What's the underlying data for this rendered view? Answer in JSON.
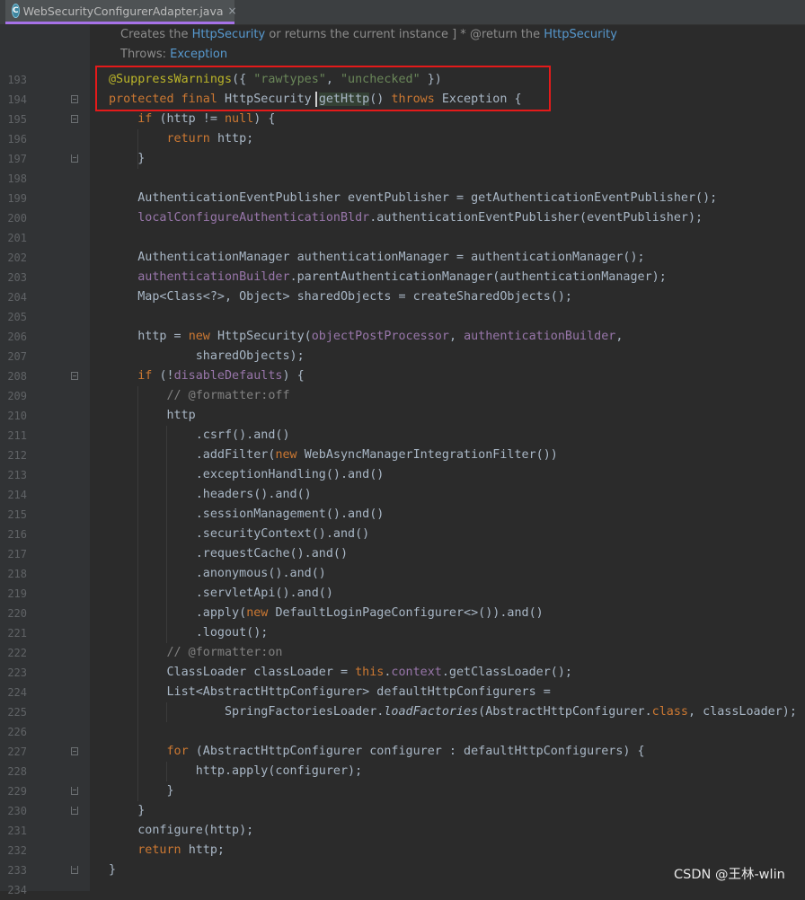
{
  "tab": {
    "title": "WebSecurityConfigurerAdapter.java",
    "icon": "java-class-icon",
    "close": "×"
  },
  "doc": {
    "line1": [
      {
        "t": "Creates the ",
        "c": ""
      },
      {
        "t": "HttpSecurity",
        "c": "code"
      },
      {
        "t": " or returns the current instance ] * @return the ",
        "c": ""
      },
      {
        "t": "HttpSecurity",
        "c": "code"
      }
    ],
    "line2": [
      {
        "t": "Throws: ",
        "c": ""
      },
      {
        "t": "Exception",
        "c": "code"
      }
    ]
  },
  "code_lines": [
    {
      "n": "193",
      "tokens": [
        [
          "@SuppressWarnings",
          "ann"
        ],
        [
          "({ ",
          ""
        ],
        [
          "\"rawtypes\"",
          "str"
        ],
        [
          ", ",
          ""
        ],
        [
          "\"unchecked\"",
          "str"
        ],
        [
          " })",
          ""
        ]
      ]
    },
    {
      "n": "194",
      "fold": "start",
      "tokens": [
        [
          "protected final ",
          "kw"
        ],
        [
          "HttpSecurity ",
          ""
        ],
        [
          "getHttp",
          "hl"
        ],
        [
          "() ",
          ""
        ],
        [
          "throws ",
          "kw"
        ],
        [
          "Exception {",
          ""
        ]
      ]
    },
    {
      "n": "195",
      "fold": "start",
      "tokens": [
        [
          "    "
        ],
        [
          "if ",
          "kw"
        ],
        [
          "(http != ",
          ""
        ],
        [
          "null",
          "kw"
        ],
        [
          ") {",
          ""
        ]
      ]
    },
    {
      "n": "196",
      "tokens": [
        [
          "        "
        ],
        [
          "return ",
          "kw"
        ],
        [
          "http;",
          ""
        ]
      ]
    },
    {
      "n": "197",
      "fold": "end",
      "tokens": [
        [
          "    }",
          ""
        ]
      ]
    },
    {
      "n": "198",
      "tokens": []
    },
    {
      "n": "199",
      "tokens": [
        [
          "    AuthenticationEventPublisher eventPublisher = getAuthenticationEventPublisher();",
          ""
        ]
      ]
    },
    {
      "n": "200",
      "tokens": [
        [
          "    "
        ],
        [
          "localConfigureAuthenticationBldr",
          "fld"
        ],
        [
          ".authenticationEventPublisher(eventPublisher);",
          ""
        ]
      ]
    },
    {
      "n": "201",
      "tokens": []
    },
    {
      "n": "202",
      "tokens": [
        [
          "    AuthenticationManager authenticationManager = authenticationManager();",
          ""
        ]
      ]
    },
    {
      "n": "203",
      "tokens": [
        [
          "    "
        ],
        [
          "authenticationBuilder",
          "fld"
        ],
        [
          ".parentAuthenticationManager(authenticationManager);",
          ""
        ]
      ]
    },
    {
      "n": "204",
      "tokens": [
        [
          "    Map<Class<?>, Object> sharedObjects = createSharedObjects();",
          ""
        ]
      ]
    },
    {
      "n": "205",
      "tokens": []
    },
    {
      "n": "206",
      "tokens": [
        [
          "    http = ",
          ""
        ],
        [
          "new ",
          "kw"
        ],
        [
          "HttpSecurity(",
          ""
        ],
        [
          "objectPostProcessor",
          "fld"
        ],
        [
          ", ",
          ""
        ],
        [
          "authenticationBuilder",
          "fld"
        ],
        [
          ",",
          ""
        ]
      ]
    },
    {
      "n": "207",
      "tokens": [
        [
          "            sharedObjects);",
          ""
        ]
      ]
    },
    {
      "n": "208",
      "fold": "start",
      "tokens": [
        [
          "    "
        ],
        [
          "if ",
          "kw"
        ],
        [
          "(!",
          ""
        ],
        [
          "disableDefaults",
          "fld"
        ],
        [
          ") {",
          ""
        ]
      ]
    },
    {
      "n": "209",
      "tokens": [
        [
          "        "
        ],
        [
          "// @formatter:off",
          "cmt"
        ]
      ]
    },
    {
      "n": "210",
      "tokens": [
        [
          "        http",
          ""
        ]
      ]
    },
    {
      "n": "211",
      "tokens": [
        [
          "            .csrf().and()",
          ""
        ]
      ]
    },
    {
      "n": "212",
      "tokens": [
        [
          "            .addFilter(",
          ""
        ],
        [
          "new ",
          "kw"
        ],
        [
          "WebAsyncManagerIntegrationFilter())",
          ""
        ]
      ]
    },
    {
      "n": "213",
      "tokens": [
        [
          "            .exceptionHandling().and()",
          ""
        ]
      ]
    },
    {
      "n": "214",
      "tokens": [
        [
          "            .headers().and()",
          ""
        ]
      ]
    },
    {
      "n": "215",
      "tokens": [
        [
          "            .sessionManagement().and()",
          ""
        ]
      ]
    },
    {
      "n": "216",
      "tokens": [
        [
          "            .securityContext().and()",
          ""
        ]
      ]
    },
    {
      "n": "217",
      "tokens": [
        [
          "            .requestCache().and()",
          ""
        ]
      ]
    },
    {
      "n": "218",
      "tokens": [
        [
          "            .anonymous().and()",
          ""
        ]
      ]
    },
    {
      "n": "219",
      "tokens": [
        [
          "            .servletApi().and()",
          ""
        ]
      ]
    },
    {
      "n": "220",
      "tokens": [
        [
          "            .apply(",
          ""
        ],
        [
          "new ",
          "kw"
        ],
        [
          "DefaultLoginPageConfigurer<>()).and()",
          ""
        ]
      ]
    },
    {
      "n": "221",
      "tokens": [
        [
          "            .logout();",
          ""
        ]
      ]
    },
    {
      "n": "222",
      "tokens": [
        [
          "        "
        ],
        [
          "// @formatter:on",
          "cmt"
        ]
      ]
    },
    {
      "n": "223",
      "tokens": [
        [
          "        ClassLoader classLoader = ",
          ""
        ],
        [
          "this",
          "kw"
        ],
        [
          ".",
          ""
        ],
        [
          "context",
          "fld"
        ],
        [
          ".getClassLoader();",
          ""
        ]
      ]
    },
    {
      "n": "224",
      "tokens": [
        [
          "        List<AbstractHttpConfigurer> defaultHttpConfigurers =",
          ""
        ]
      ]
    },
    {
      "n": "225",
      "tokens": [
        [
          "                SpringFactoriesLoader.",
          ""
        ],
        [
          "loadFactories",
          "it"
        ],
        [
          "(AbstractHttpConfigurer.",
          ""
        ],
        [
          "class",
          "kw"
        ],
        [
          ", classLoader);",
          ""
        ]
      ]
    },
    {
      "n": "226",
      "tokens": []
    },
    {
      "n": "227",
      "fold": "start",
      "tokens": [
        [
          "        "
        ],
        [
          "for ",
          "kw"
        ],
        [
          "(AbstractHttpConfigurer configurer : defaultHttpConfigurers) {",
          ""
        ]
      ]
    },
    {
      "n": "228",
      "tokens": [
        [
          "            http.apply(configurer);",
          ""
        ]
      ]
    },
    {
      "n": "229",
      "fold": "end",
      "tokens": [
        [
          "        }",
          ""
        ]
      ]
    },
    {
      "n": "230",
      "fold": "end",
      "tokens": [
        [
          "    }",
          ""
        ]
      ]
    },
    {
      "n": "231",
      "tokens": [
        [
          "    configure(http);",
          ""
        ]
      ]
    },
    {
      "n": "232",
      "tokens": [
        [
          "    "
        ],
        [
          "return ",
          "kw"
        ],
        [
          "http;",
          ""
        ]
      ]
    },
    {
      "n": "233",
      "fold": "end",
      "tokens": [
        [
          "}",
          ""
        ]
      ]
    },
    {
      "n": "234",
      "tokens": []
    }
  ],
  "watermark": "CSDN @王林-wlin",
  "colors": {
    "annotation_box": "#e41a1a",
    "tab_underline": "#a672e8"
  }
}
